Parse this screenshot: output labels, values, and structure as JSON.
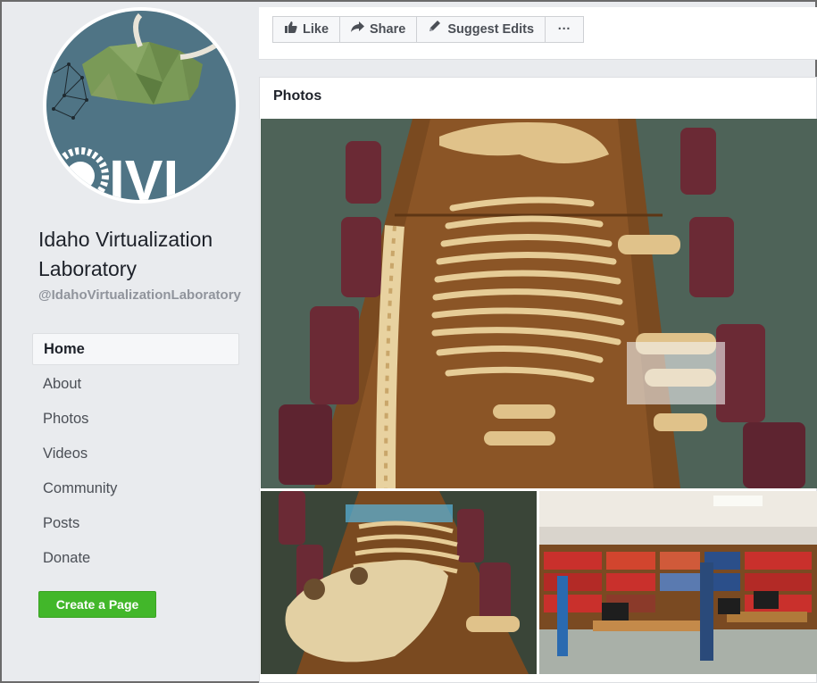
{
  "page": {
    "name": "Idaho Virtualization Laboratory",
    "handle": "@IdahoVirtualizationLaboratory",
    "avatar_text": "IVL"
  },
  "nav": {
    "items": [
      {
        "label": "Home",
        "active": true
      },
      {
        "label": "About"
      },
      {
        "label": "Photos"
      },
      {
        "label": "Videos"
      },
      {
        "label": "Community"
      },
      {
        "label": "Posts"
      },
      {
        "label": "Donate"
      }
    ]
  },
  "create_page_label": "Create a Page",
  "actions": {
    "like": "Like",
    "share": "Share",
    "suggest_edits": "Suggest Edits",
    "more": "···"
  },
  "icons": {
    "like": "thumbs-up-icon",
    "share": "share-arrow-icon",
    "suggest_edits": "pencil-icon",
    "more": "ellipsis-icon"
  },
  "photos": {
    "title": "Photos",
    "items": [
      "skeleton-on-tables",
      "rhino-skull-skeleton",
      "library-lab-room"
    ]
  },
  "colors": {
    "page_bg": "#e9ebee",
    "create_button": "#42b72a",
    "avatar_bg": "#4f7485"
  }
}
